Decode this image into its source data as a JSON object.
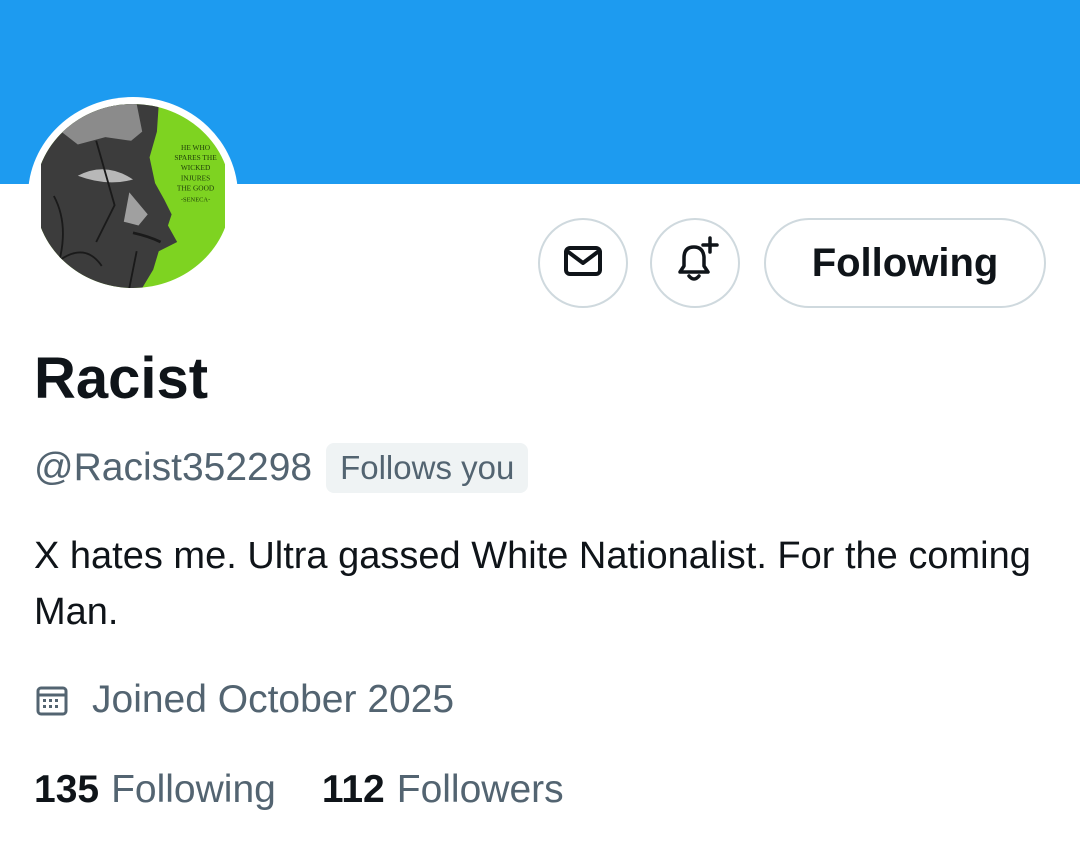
{
  "profile": {
    "display_name": "Racist",
    "handle": "@Racist352298",
    "follows_you": "Follows you",
    "bio": "X hates me. Ultra gassed White Nationalist. For the coming Man.",
    "joined": "Joined October 2025",
    "avatar_quote": [
      "HE WHO",
      "SPARES THE",
      "WICKED",
      "INJURES",
      "THE GOOD",
      "-SENECA-"
    ]
  },
  "actions": {
    "message_icon": "envelope-icon",
    "notify_icon": "bell-plus-icon",
    "following_label": "Following"
  },
  "stats": {
    "following_count": "135",
    "following_label": "Following",
    "followers_count": "112",
    "followers_label": "Followers"
  },
  "colors": {
    "banner": "#1d9bf0",
    "secondary_text": "#536471",
    "primary_text": "#0f1419",
    "border": "#cfd9de",
    "avatar_green": "#7ed321"
  }
}
